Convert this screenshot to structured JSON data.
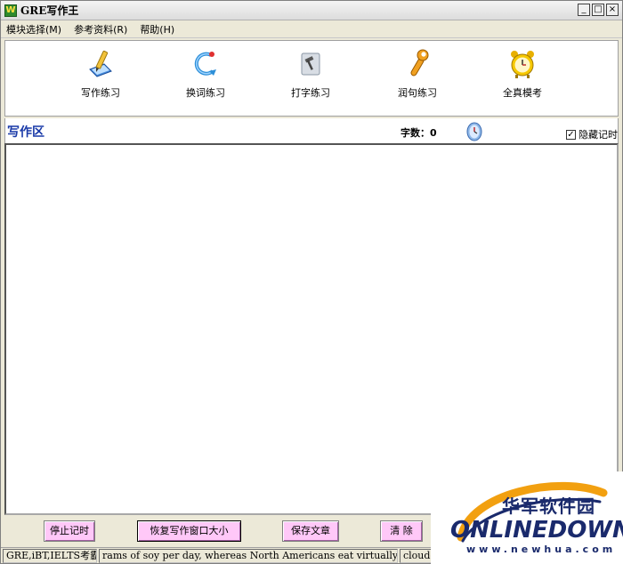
{
  "window": {
    "title": "GRE写作王"
  },
  "menu": [
    {
      "label": "模块选择(M)"
    },
    {
      "label": "参考资料(R)"
    },
    {
      "label": "帮助(H)"
    }
  ],
  "toolbar": [
    {
      "label": "写作练习",
      "icon": "pen-paper-icon"
    },
    {
      "label": "换词练习",
      "icon": "swap-arrow-icon"
    },
    {
      "label": "打字练习",
      "icon": "hammer-icon"
    },
    {
      "label": "润句练习",
      "icon": "wrench-icon"
    },
    {
      "label": "全真模考",
      "icon": "alarm-clock-icon"
    }
  ],
  "writing": {
    "title": "写作区",
    "char_count": "字数：0",
    "hide_timer_label": "隐藏记时",
    "hide_timer_checked": true,
    "text": ""
  },
  "buttons": {
    "stop_timer": "停止记时",
    "restore_window": "恢复写作窗口大小",
    "save": "保存文章",
    "clear": "清 除"
  },
  "status": {
    "series": "GRE,iBT,IELTS考霸系列",
    "ticker": "rams of soy per day, whereas North Americans eat virtually none. It turns o",
    "extra": "cloudcr"
  },
  "watermark": {
    "cn": "华军软件园",
    "en": "ONLINEDOWN",
    "url": "www.newhua.com"
  },
  "colors": {
    "button_pink": "#ffc8f8",
    "area_title_blue": "#1a3aa8",
    "window_bg": "#ece9d8"
  }
}
